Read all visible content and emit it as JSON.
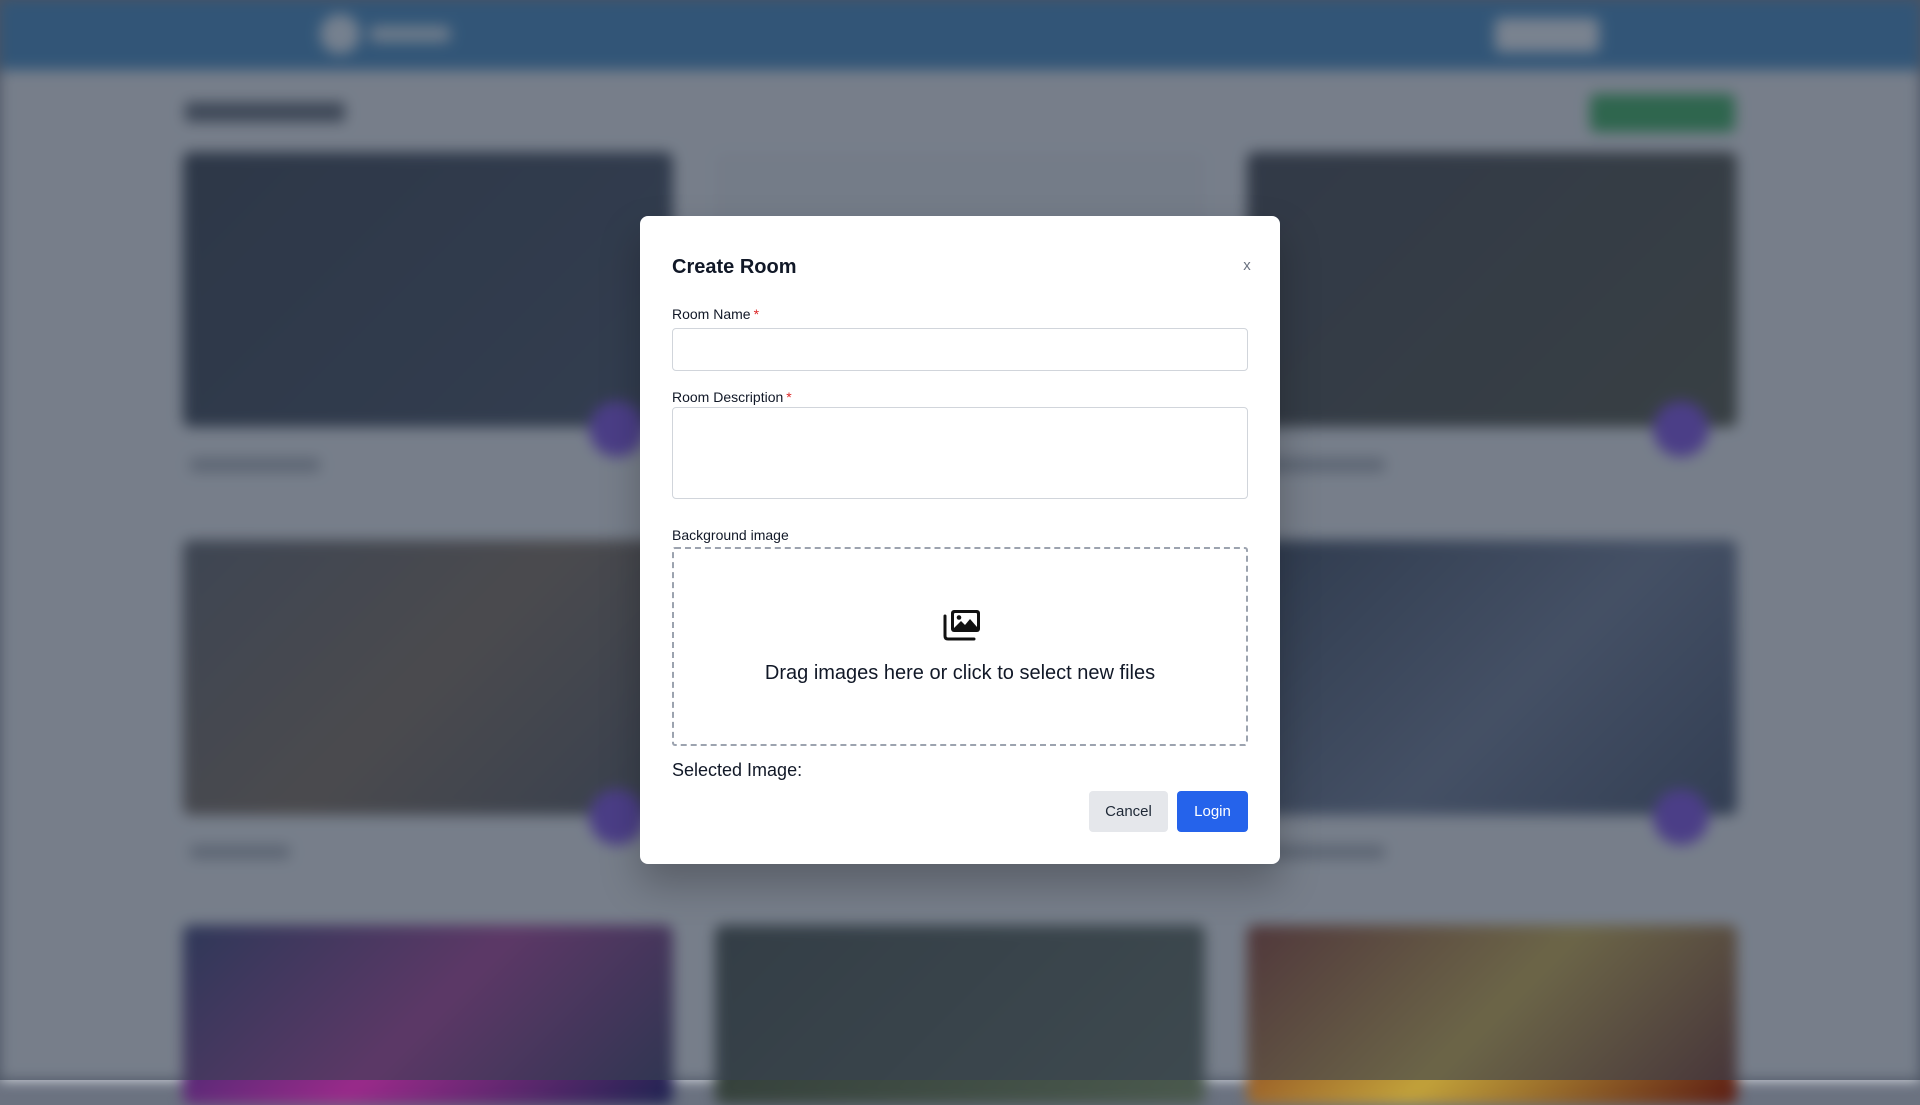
{
  "modal": {
    "title": "Create Room",
    "close_label": "x",
    "room_name": {
      "label": "Room Name",
      "required_mark": "*",
      "value": ""
    },
    "room_description": {
      "label": "Room Description",
      "required_mark": "*",
      "value": ""
    },
    "background_image": {
      "label": "Background image",
      "dropzone_text": "Drag images here or click to select new files",
      "dropzone_icon": "images-icon"
    },
    "selected_image_label": "Selected Image:",
    "cancel_label": "Cancel",
    "submit_label": "Login"
  },
  "colors": {
    "topbar": "#2b78b6",
    "primary_button": "#2563eb",
    "secondary_button": "#e5e7eb",
    "required_mark": "#dc2626",
    "create_button": "#22a24a",
    "card_fab": "#6d3be0"
  }
}
